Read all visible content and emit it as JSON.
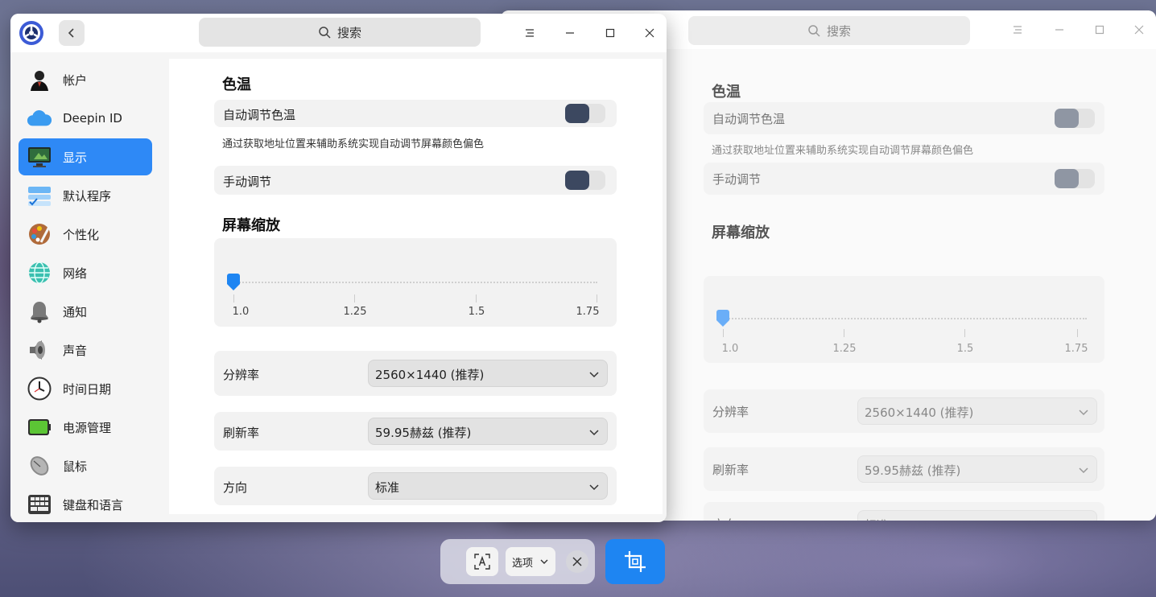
{
  "colors": {
    "accent": "#2e89f6",
    "toggle_off": "#3c4860",
    "capture_button": "#1e85f2"
  },
  "search": {
    "placeholder": "搜索"
  },
  "sidebar": {
    "items": [
      {
        "label": "帐户",
        "icon": "account-icon"
      },
      {
        "label": "Deepin ID",
        "icon": "cloud-icon"
      },
      {
        "label": "显示",
        "icon": "display-icon",
        "active": true
      },
      {
        "label": "默认程序",
        "icon": "default-apps-icon"
      },
      {
        "label": "个性化",
        "icon": "personalization-icon"
      },
      {
        "label": "网络",
        "icon": "network-icon"
      },
      {
        "label": "通知",
        "icon": "bell-icon"
      },
      {
        "label": "声音",
        "icon": "speaker-icon"
      },
      {
        "label": "时间日期",
        "icon": "clock-icon"
      },
      {
        "label": "电源管理",
        "icon": "battery-icon"
      },
      {
        "label": "鼠标",
        "icon": "mouse-icon"
      },
      {
        "label": "键盘和语言",
        "icon": "keyboard-icon"
      }
    ]
  },
  "display": {
    "color_temp": {
      "title": "色温",
      "auto_label": "自动调节色温",
      "auto_enabled": false,
      "auto_desc": "通过获取地址位置来辅助系统实现自动调节屏幕颜色偏色",
      "manual_label": "手动调节",
      "manual_enabled": false
    },
    "scaling": {
      "title": "屏幕缩放",
      "ticks": [
        "1.0",
        "1.25",
        "1.5",
        "1.75"
      ],
      "value": 1.0
    },
    "resolution": {
      "label": "分辨率",
      "value": "2560×1440 (推荐)"
    },
    "refresh": {
      "label": "刷新率",
      "value": "59.95赫兹 (推荐)"
    },
    "orientation": {
      "label": "方向",
      "value": "标准"
    }
  },
  "toolbar": {
    "options_label": "选项"
  }
}
